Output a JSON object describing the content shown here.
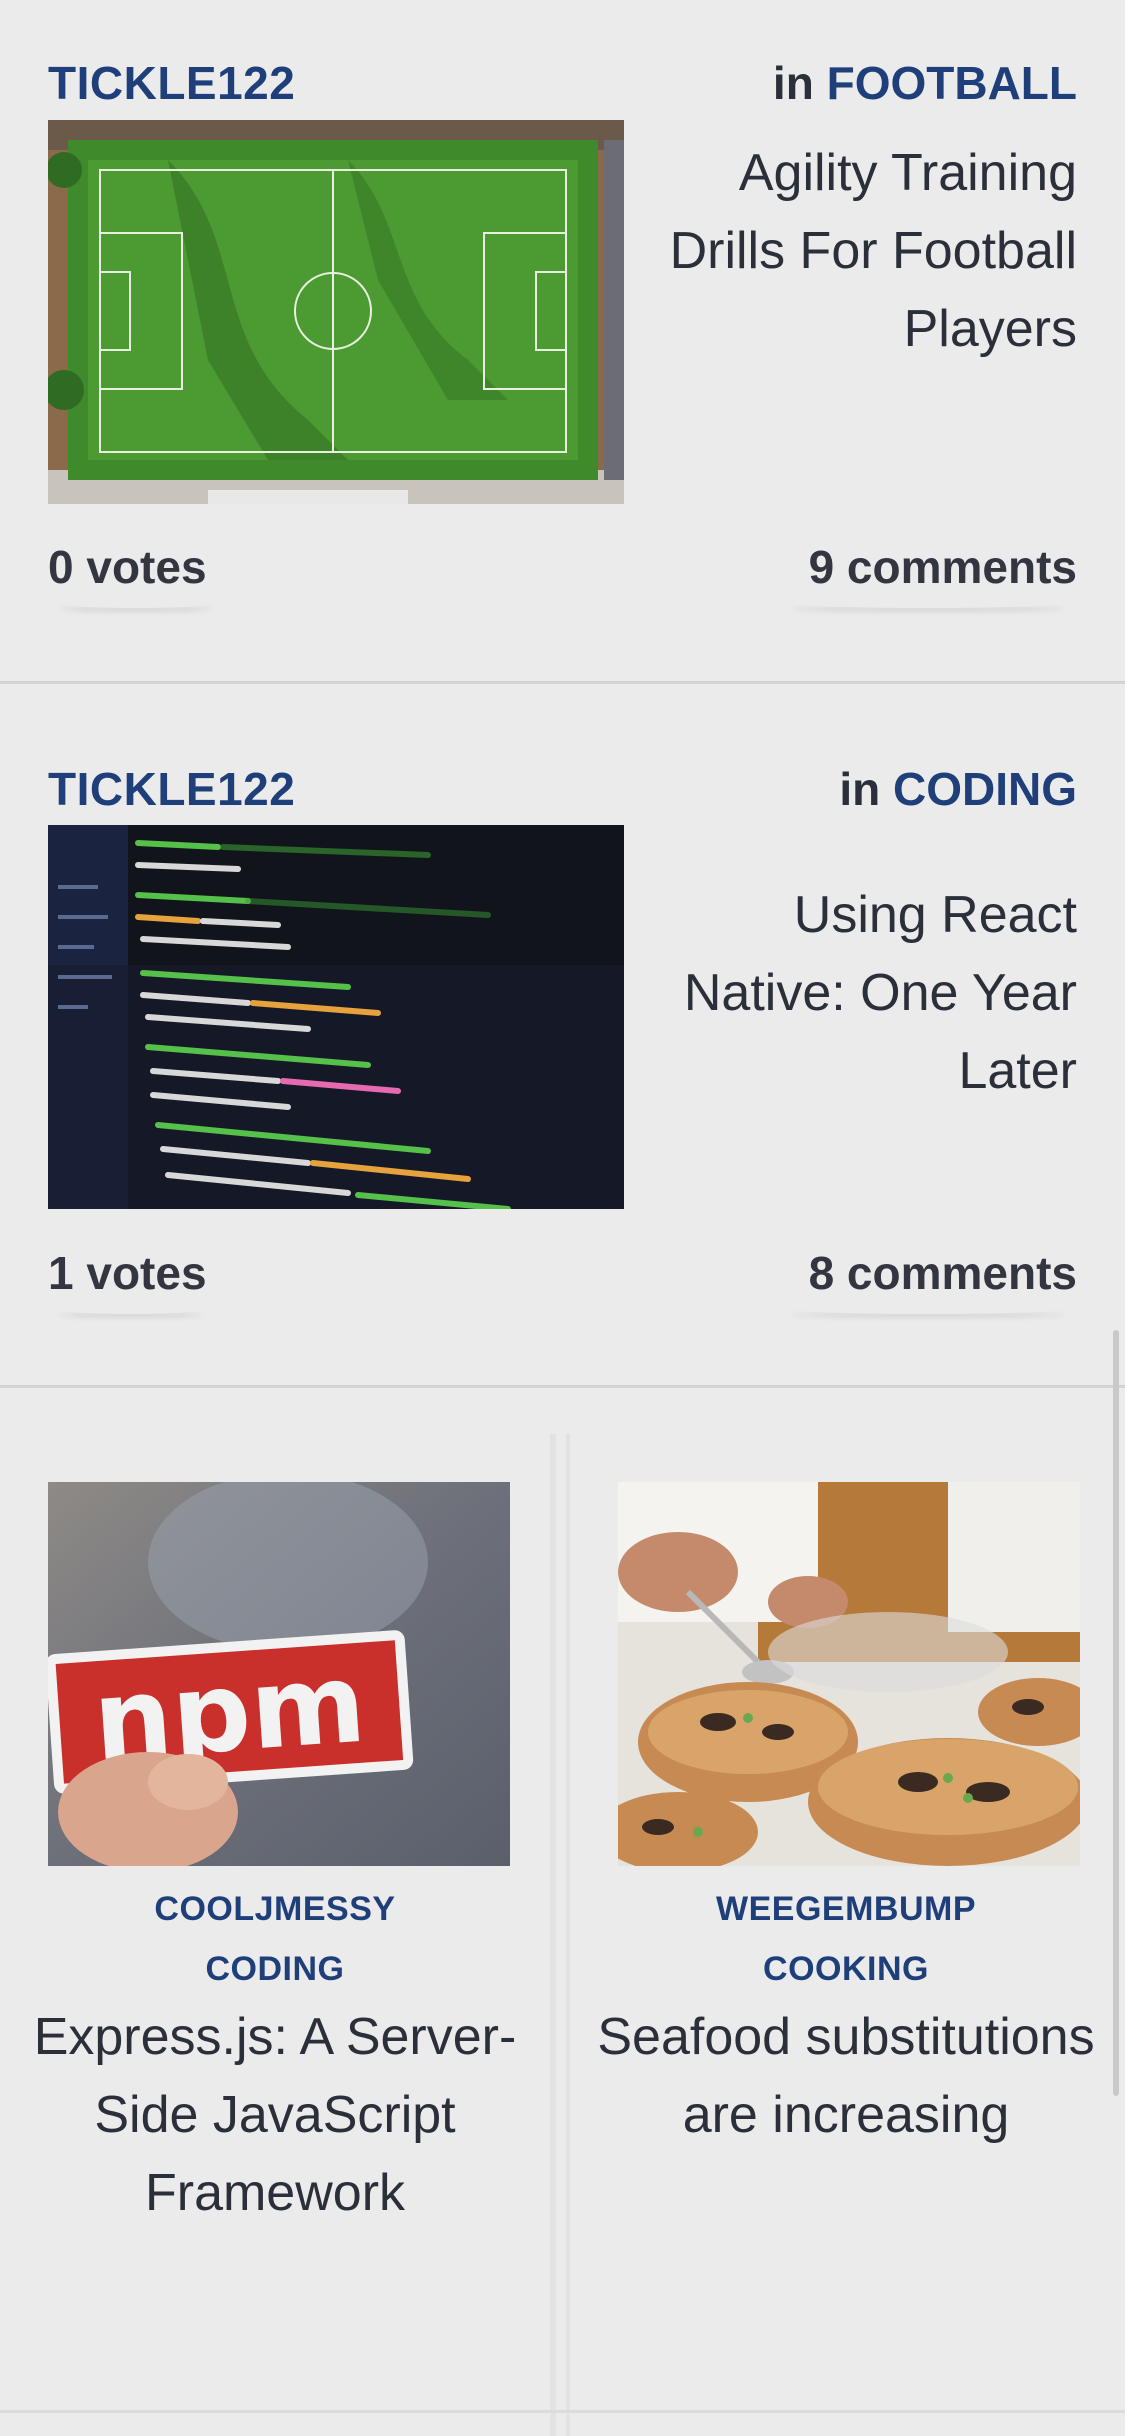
{
  "posts": [
    {
      "author": "TICKLE122",
      "in_label": "in",
      "category": "FOOTBALL",
      "title": "Agility Training Drills For Football Players",
      "votes": "0 votes",
      "comments": "9 comments",
      "image_icon": "football-field-photo"
    },
    {
      "author": "TICKLE122",
      "in_label": "in",
      "category": "CODING",
      "title": "Using React Native: One Year Later",
      "votes": "1 votes",
      "comments": "8 comments",
      "image_icon": "code-screen-photo"
    }
  ],
  "cards": [
    {
      "author": "COOLJMESSY",
      "category": "CODING",
      "title": "Express.js: A Server-Side JavaScript Framework",
      "image_icon": "npm-sticker-photo",
      "sticker_text": "npm"
    },
    {
      "author": "WEEGEMBUMP",
      "category": "COOKING",
      "title": "Seafood substitutions are increasing",
      "image_icon": "chef-plating-photo"
    }
  ],
  "colors": {
    "background": "#ebebeb",
    "accent_blue": "#1f3f7a",
    "text_dark": "#2a2f3a",
    "npm_red": "#c9302c"
  }
}
